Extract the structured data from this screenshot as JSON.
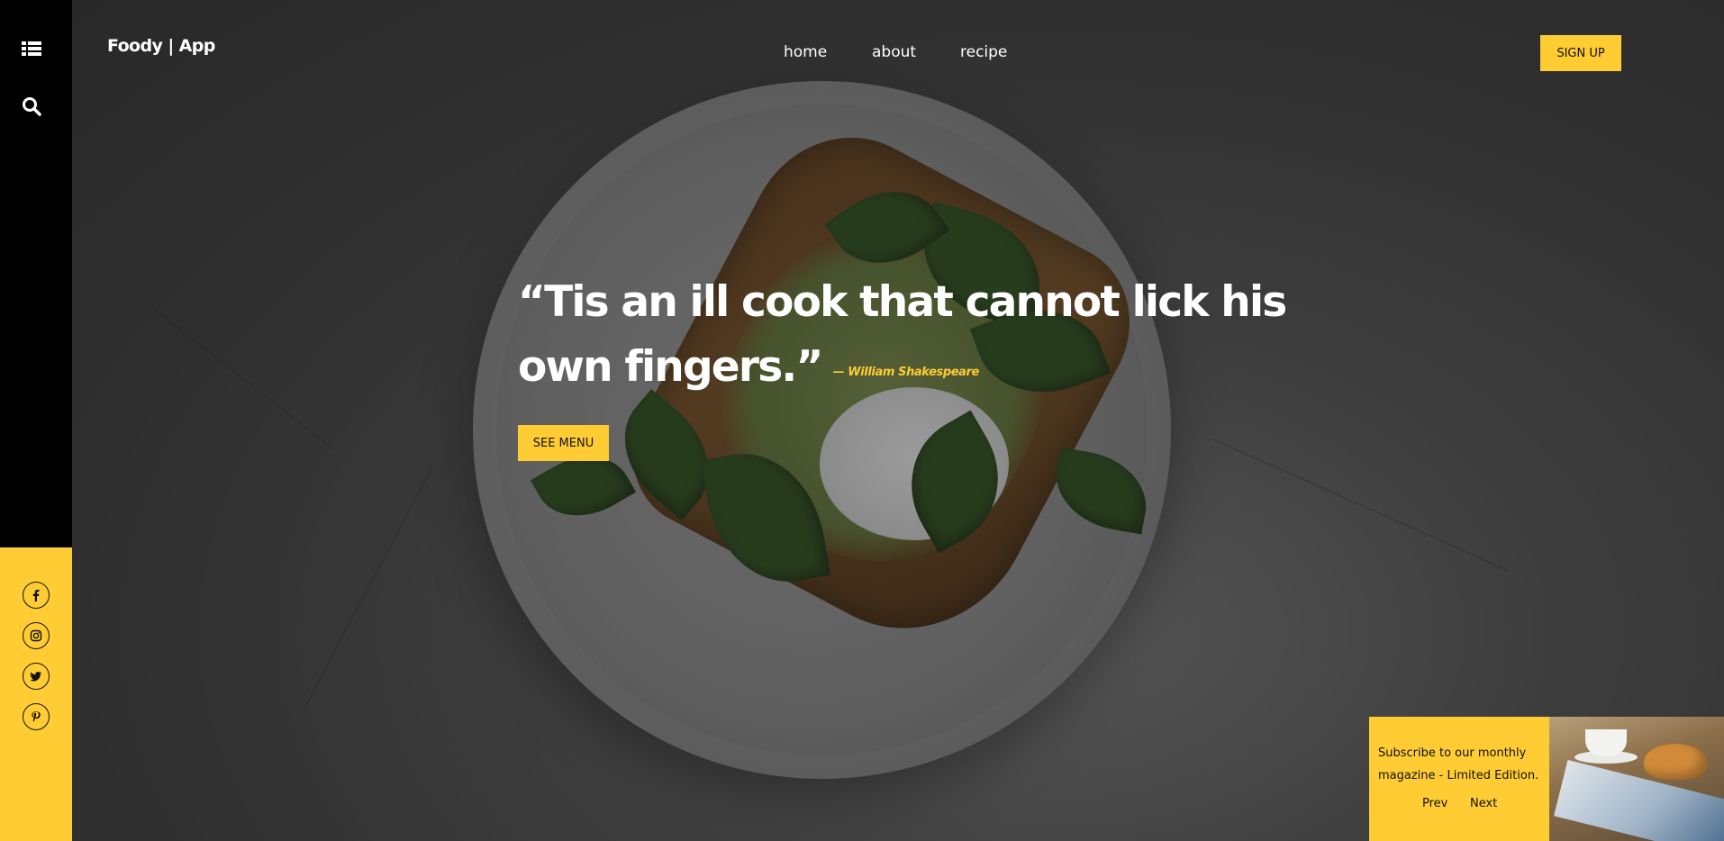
{
  "brand": {
    "logo": "Foody | App"
  },
  "nav": {
    "items": [
      {
        "label": "home"
      },
      {
        "label": "about"
      },
      {
        "label": "recipe"
      }
    ],
    "signup_label": "SIGN UP"
  },
  "sidebar": {
    "icons": [
      "list-icon",
      "search-icon"
    ],
    "social": [
      "facebook-icon",
      "instagram-icon",
      "twitter-icon",
      "pinterest-icon"
    ]
  },
  "hero": {
    "quote": "“Tis an ill cook that cannot lick his own fingers.”",
    "attribution": "— William Shakespeare",
    "cta_label": "SEE MENU"
  },
  "subscribe": {
    "text": "Subscribe to our monthly magazine - Limited Edition.",
    "prev_label": "Prev",
    "next_label": "Next"
  },
  "colors": {
    "accent": "#ffcc33",
    "sidebar_dark": "#000000",
    "text_light": "#ffffff"
  }
}
